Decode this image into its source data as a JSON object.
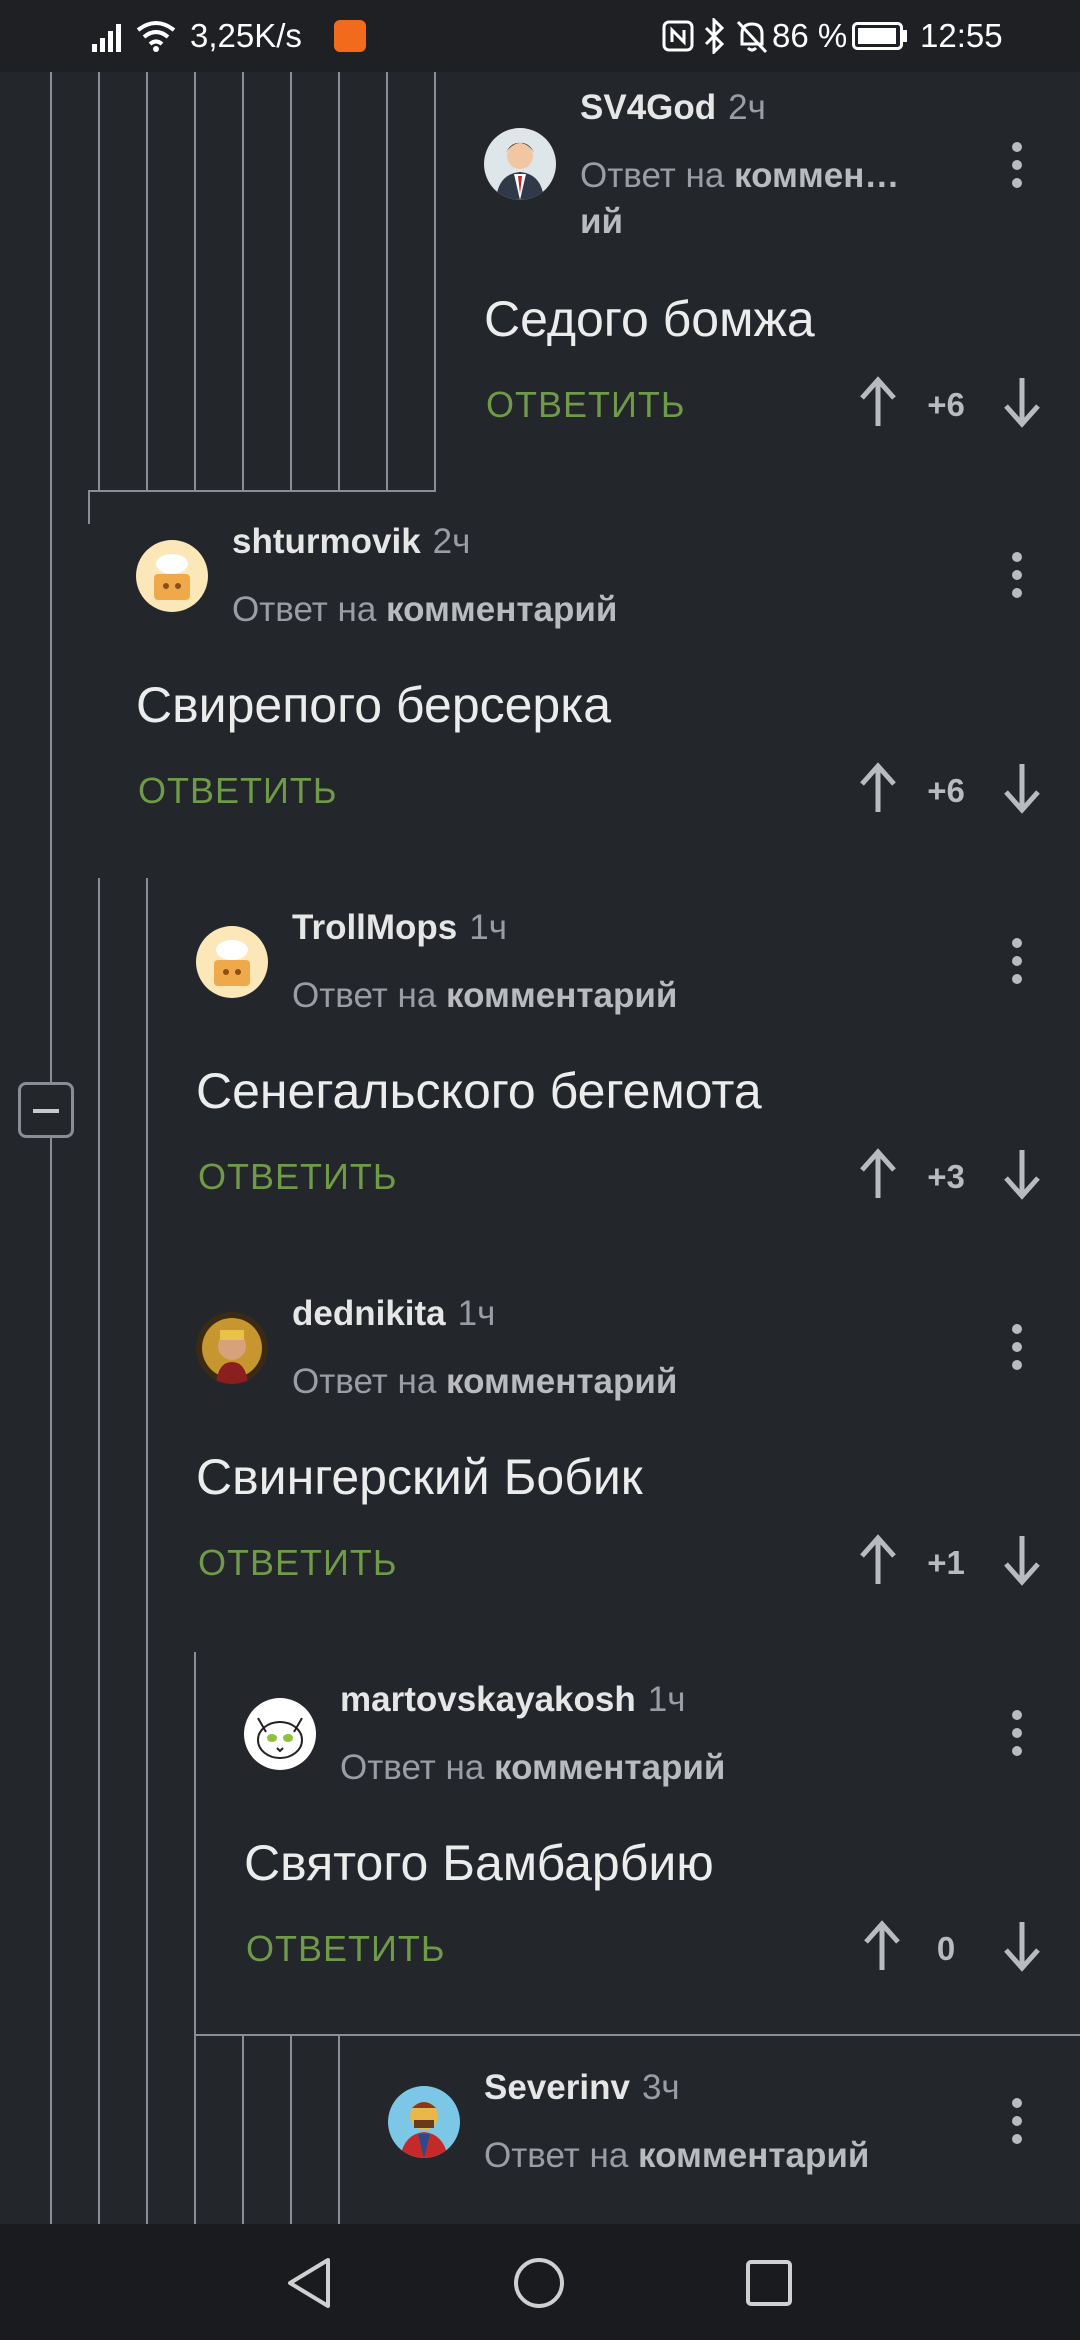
{
  "status_bar": {
    "net_speed": "3,25K/s",
    "battery": "86 %",
    "time": "12:55"
  },
  "reply_label": "ОТВЕТИТЬ",
  "comments": [
    {
      "author": "SV4God",
      "time": "2ч",
      "reply_prefix": "Ответ на",
      "reply_target": "коммен…",
      "reply_target_cont": "ий",
      "text": "Седого бомжа",
      "score": "+6"
    },
    {
      "author": "shturmovik",
      "time": "2ч",
      "reply_prefix": "Ответ на",
      "reply_target": "комментарий",
      "text": "Свирепого берсерка",
      "score": "+6"
    },
    {
      "author": "TrollMops",
      "time": "1ч",
      "reply_prefix": "Ответ на",
      "reply_target": "комментарий",
      "text": "Сенегальского бегемота",
      "score": "+3"
    },
    {
      "author": "dednikita",
      "time": "1ч",
      "reply_prefix": "Ответ на",
      "reply_target": "комментарий",
      "text": "Свингерский Бобик",
      "score": "+1"
    },
    {
      "author": "martovskayakosh",
      "time": "1ч",
      "reply_prefix": "Ответ на",
      "reply_target": "комментарий",
      "text": "Святого Бамбарбию",
      "score": "0"
    },
    {
      "author": "Severinv",
      "time": "3ч",
      "reply_prefix": "Ответ на",
      "reply_target": "комментарий"
    }
  ]
}
